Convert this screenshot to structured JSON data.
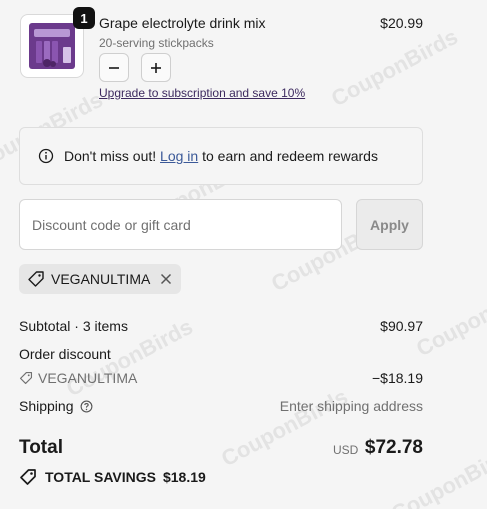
{
  "product": {
    "title": "Grape electrolyte drink mix",
    "variant": "20-serving stickpacks",
    "price": "$20.99",
    "quantity": "1",
    "upgrade_link": "Upgrade to subscription and save 10%",
    "image_colors": {
      "bg": "#6b3a8c",
      "accent": "#9b6bc0"
    }
  },
  "rewards": {
    "prefix": "Don't miss out!",
    "link": "Log in",
    "suffix": "to earn and redeem rewards"
  },
  "discount": {
    "placeholder": "Discount code or gift card",
    "apply_label": "Apply",
    "applied_code": "VEGANULTIMA"
  },
  "summary": {
    "subtotal_label": "Subtotal · 3 items",
    "subtotal_value": "$90.97",
    "order_discount_label": "Order discount",
    "discount_code": "VEGANULTIMA",
    "discount_value": "−$18.19",
    "shipping_label": "Shipping",
    "shipping_value": "Enter shipping address",
    "total_label": "Total",
    "currency": "USD",
    "total_value": "$72.78",
    "savings_label": "TOTAL SAVINGS",
    "savings_value": "$18.19"
  },
  "watermark": "CouponBirds",
  "colors": {
    "link": "#3d2a5f",
    "background": "#f5f5f5",
    "text": "#1a1a1a",
    "muted": "#707070"
  }
}
